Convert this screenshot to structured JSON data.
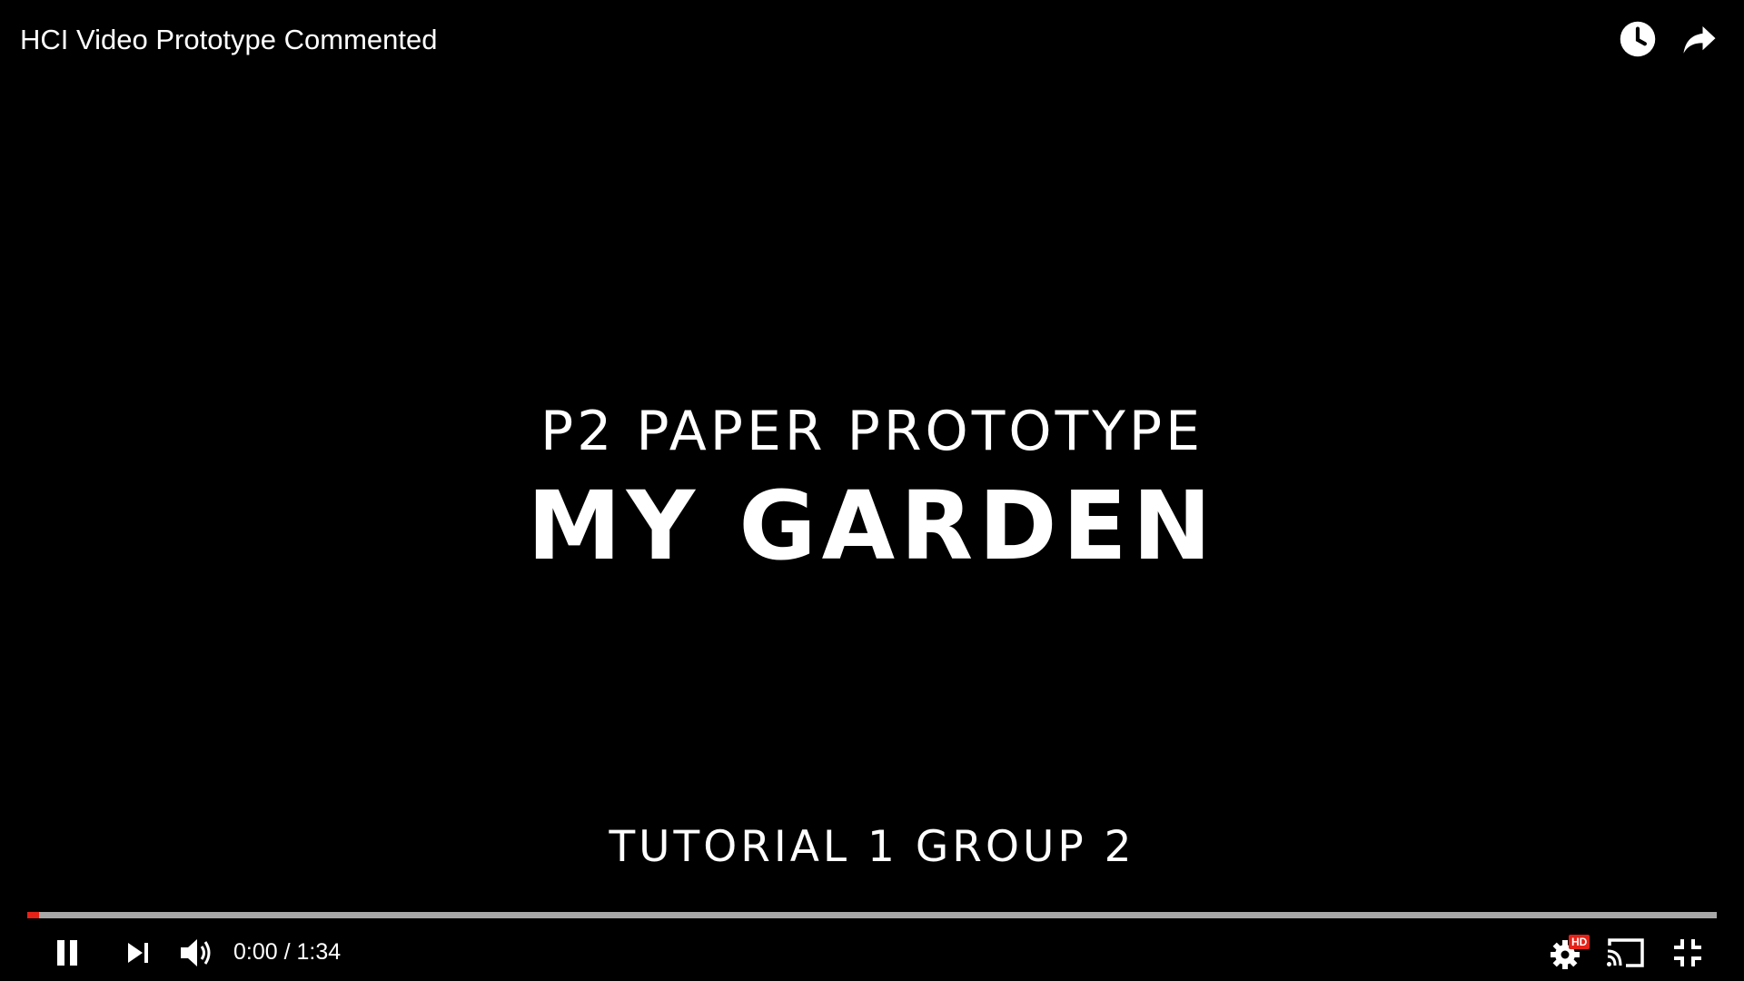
{
  "video": {
    "title": "HCI Video Prototype Commented"
  },
  "frame": {
    "subtitle": "P2 PAPER PROTOTYPE",
    "headline": "MY GARDEN",
    "footer": "TUTORIAL 1 GROUP 2"
  },
  "controls": {
    "current_time": "0:00",
    "separator": "/",
    "duration": "1:34",
    "quality_badge": "HD",
    "progress_fraction": 0.007
  },
  "icons": {
    "watch_later": "clock-icon",
    "share": "share-arrow-icon",
    "pause": "pause-icon",
    "next": "skip-next-icon",
    "volume": "volume-icon",
    "settings": "gear-icon",
    "cast": "cast-icon",
    "exit_fullscreen": "exit-fullscreen-icon"
  },
  "colors": {
    "progress_played": "#e62117",
    "progress_track": "#a8a8a8",
    "hd_badge": "#e62117"
  }
}
